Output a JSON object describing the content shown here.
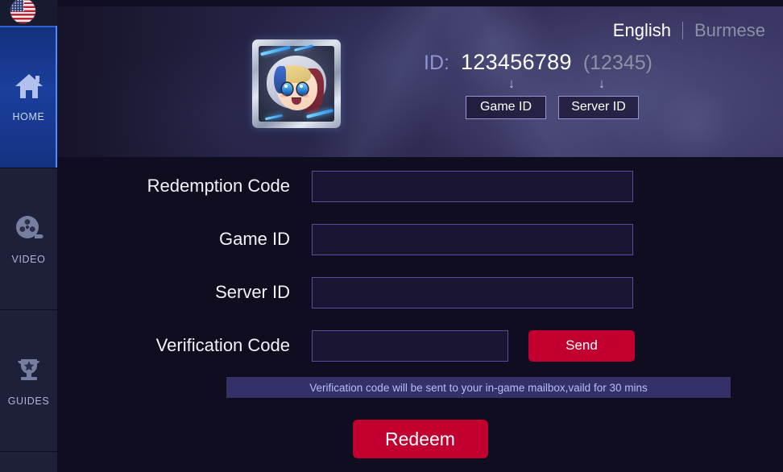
{
  "sidebar": {
    "flag": "us-flag-icon",
    "items": [
      {
        "label": "HOME",
        "icon": "home-icon",
        "active": true
      },
      {
        "label": "VIDEO",
        "icon": "film-reel-icon",
        "active": false
      },
      {
        "label": "GUIDES",
        "icon": "trophy-icon",
        "active": false
      }
    ]
  },
  "banner": {
    "languages": [
      {
        "label": "English",
        "active": true
      },
      {
        "label": "Burmese",
        "active": false
      }
    ],
    "avatar_alt": "player-avatar",
    "id_label": "ID:",
    "id_primary": "123456789",
    "id_secondary": "(12345)",
    "arrow_glyph": "↓",
    "tags": [
      {
        "label": "Game ID"
      },
      {
        "label": "Server ID"
      }
    ]
  },
  "form": {
    "rows": [
      {
        "label": "Redemption Code",
        "value": "",
        "placeholder": ""
      },
      {
        "label": "Game ID",
        "value": "",
        "placeholder": ""
      },
      {
        "label": "Server ID",
        "value": "",
        "placeholder": ""
      },
      {
        "label": "Verification Code",
        "value": "",
        "placeholder": ""
      }
    ],
    "send_label": "Send",
    "notice": "Verification code will be sent to your in-game mailbox,vaild for 30 mins",
    "redeem_label": "Redeem"
  },
  "colors": {
    "accent_red": "#C2002F",
    "sidebar_active_blue": "#1A3F9C",
    "notice_bg": "#343068",
    "input_border": "#5B4A9E",
    "page_bg": "#0F0D1F"
  }
}
